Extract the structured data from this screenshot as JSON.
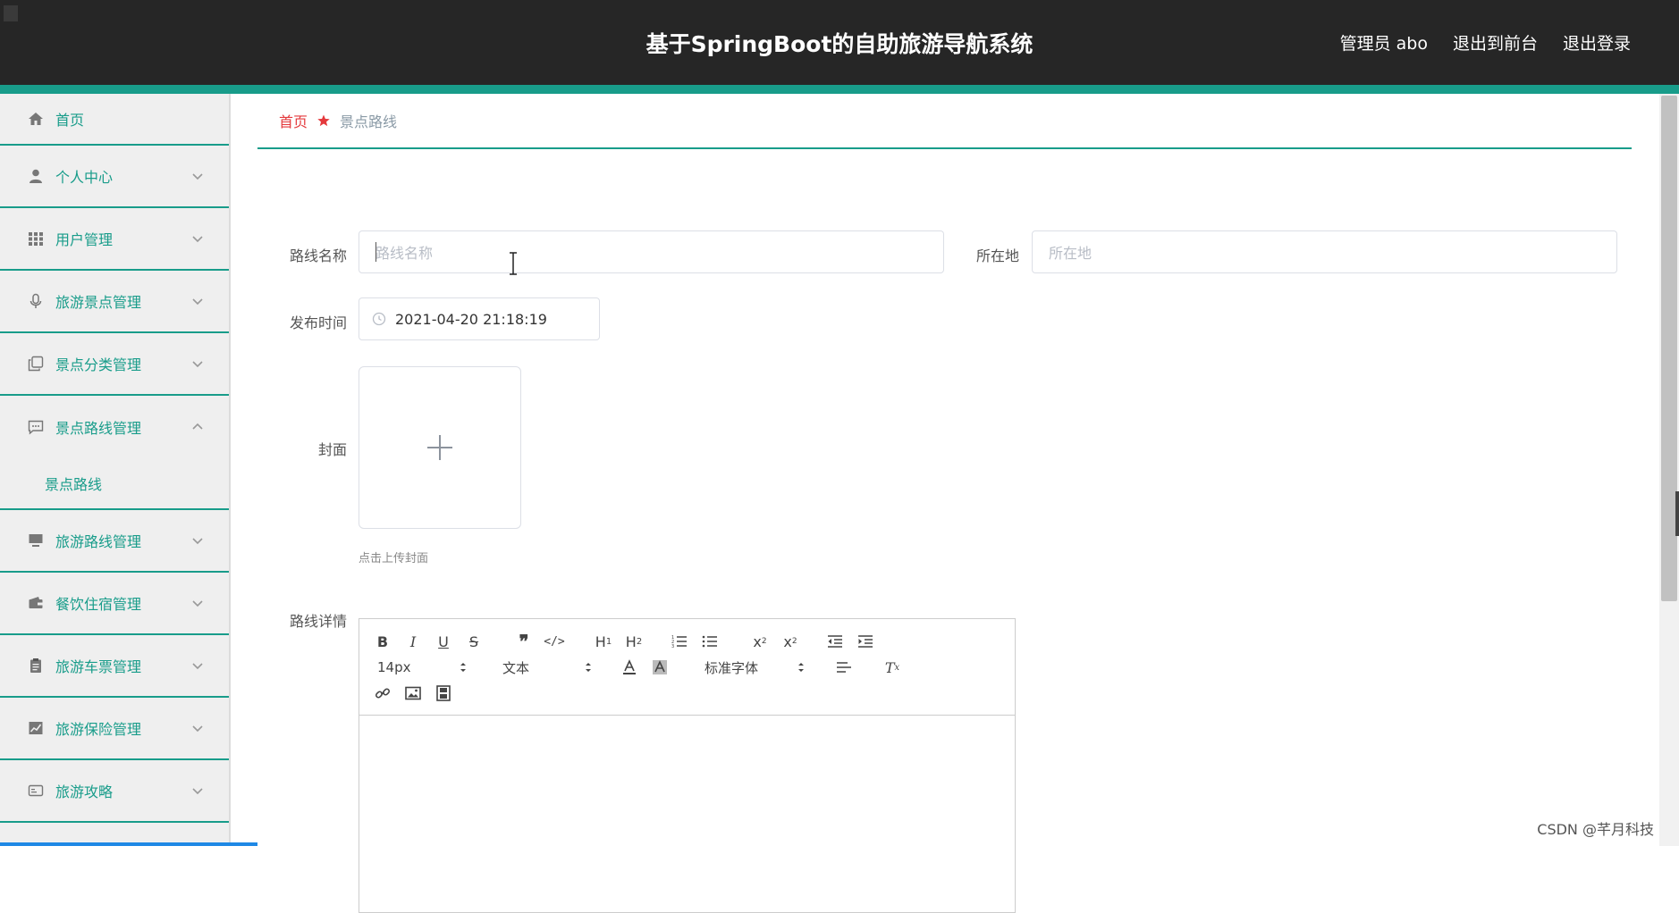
{
  "header": {
    "title": "基于SpringBoot的自助旅游导航系统",
    "user_label": "管理员 abo",
    "to_front_label": "退出到前台",
    "logout_label": "退出登录"
  },
  "sidebar": {
    "items": [
      {
        "label": "首页",
        "icon": "home-icon"
      },
      {
        "label": "个人中心",
        "icon": "user-icon"
      },
      {
        "label": "用户管理",
        "icon": "grid-icon"
      },
      {
        "label": "旅游景点管理",
        "icon": "microphone-icon"
      },
      {
        "label": "景点分类管理",
        "icon": "copy-icon"
      },
      {
        "label": "景点路线管理",
        "icon": "chat-icon",
        "expanded": true,
        "sub": "景点路线"
      },
      {
        "label": "旅游路线管理",
        "icon": "monitor-icon"
      },
      {
        "label": "餐饮住宿管理",
        "icon": "wallet-icon"
      },
      {
        "label": "旅游车票管理",
        "icon": "clipboard-icon"
      },
      {
        "label": "旅游保险管理",
        "icon": "chart-icon"
      },
      {
        "label": "旅游攻略",
        "icon": "card-icon"
      }
    ]
  },
  "breadcrumb": {
    "home": "首页",
    "current": "景点路线"
  },
  "form": {
    "route_name_label": "路线名称",
    "route_name_placeholder": "路线名称",
    "location_label": "所在地",
    "location_placeholder": "所在地",
    "publish_time_label": "发布时间",
    "publish_time_value": "2021-04-20 21:18:19",
    "cover_label": "封面",
    "cover_hint": "点击上传封面",
    "detail_label": "路线详情"
  },
  "editor": {
    "font_size": "14px",
    "paragraph": "文本",
    "font_family": "标准字体"
  },
  "watermark": "CSDN @芊月科技",
  "colors": {
    "accent": "#189c8a",
    "header_bg": "#262626",
    "breadcrumb_home": "#e4393c"
  }
}
